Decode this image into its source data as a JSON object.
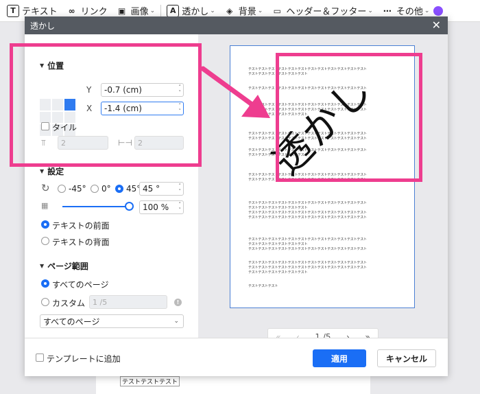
{
  "toolbar": {
    "items": [
      {
        "label": "テキスト",
        "icon": "text-icon",
        "glyph": "T"
      },
      {
        "label": "リンク",
        "icon": "link-icon",
        "glyph": "∞"
      },
      {
        "label": "画像",
        "icon": "image-icon",
        "glyph": "▣"
      },
      {
        "label": "透かし",
        "icon": "watermark-icon",
        "glyph": "A"
      },
      {
        "label": "背景",
        "icon": "background-icon",
        "glyph": "◈"
      },
      {
        "label": "ヘッダー＆フッター",
        "icon": "header-footer-icon",
        "glyph": "▭"
      },
      {
        "label": "その他",
        "icon": "more-icon",
        "glyph": "⋯"
      }
    ]
  },
  "dialog": {
    "title": "透かし",
    "position": {
      "title": "位置",
      "y_label": "Y",
      "y_value": "-0.7 (cm)",
      "x_label": "X",
      "x_value": "-1.4 (cm)",
      "tile_label": "タイル",
      "tile_count_a": "2",
      "tile_count_b": "2"
    },
    "settings": {
      "title": "設定",
      "rotation_options": [
        "-45°",
        "0°",
        "45°"
      ],
      "rotation_selected": "45°",
      "rotation_value": "45 °",
      "opacity_value": "100 %",
      "opacity_fraction": 1.0,
      "front_label": "テキストの前面",
      "back_label": "テキストの背面"
    },
    "page_range": {
      "title": "ページ範囲",
      "all_label": "すべてのページ",
      "custom_label": "カスタム",
      "custom_value": "1 /5",
      "select_value": "すべてのページ"
    },
    "preview": {
      "watermark_text": "透かし",
      "lines": [
        "テストテストテストテストテストテストテストテストテストテストテストテスト",
        "テストテストテストテストテストテスト",
        "テストテストテストテストテストテストテストテストテストテストテストテスト",
        "テストテストテストテストテストテストテストテストテストテストテストテスト",
        "テストテストテストテストテストテストテストテストテストテストテストテスト",
        "テストテストテストテストテストテスト",
        "テストテストテストテストテストテストテストテストテストテストテストテスト",
        "テストテストテストテストテストテストテストテストテストテストテストテスト",
        "テストテストテストテストテストテストテストテストテストテストテストテスト",
        "テストテストテストテストテストテスト",
        "テストテストテストテストテストテストテストテストテストテストテストテスト",
        "テストテストテストテストテストテストテストテストテストテストテストテスト",
        "テストテストテストテストテストテストテストテストテストテストテストテスト",
        "テストテストテストテストテストテスト",
        "テストテストテストテストテストテストテストテストテストテストテストテスト",
        "テストテストテストテストテストテストテストテストテストテストテストテスト",
        "テストテストテストテストテストテストテストテストテストテストテストテスト",
        "テストテストテストテストテストテスト",
        "テストテストテストテストテストテストテストテストテストテストテストテスト",
        "テストテストテストテストテストテストテストテストテストテストテストテスト",
        "テストテストテストテストテストテストテストテストテストテストテストテスト",
        "テストテストテストテストテストテスト",
        "テストテストテスト"
      ]
    },
    "pager": {
      "first": "«",
      "prev": "‹",
      "page": "1 /5",
      "next": "›",
      "last": "»"
    },
    "footer": {
      "template_label": "テンプレートに追加",
      "apply_label": "適用",
      "cancel_label": "キャンセル"
    }
  },
  "background_doc": {
    "text": "テストテストテスト"
  },
  "colors": {
    "accent": "#1a6ef5",
    "annotation": "#ee3d8f",
    "header": "#555a61"
  }
}
